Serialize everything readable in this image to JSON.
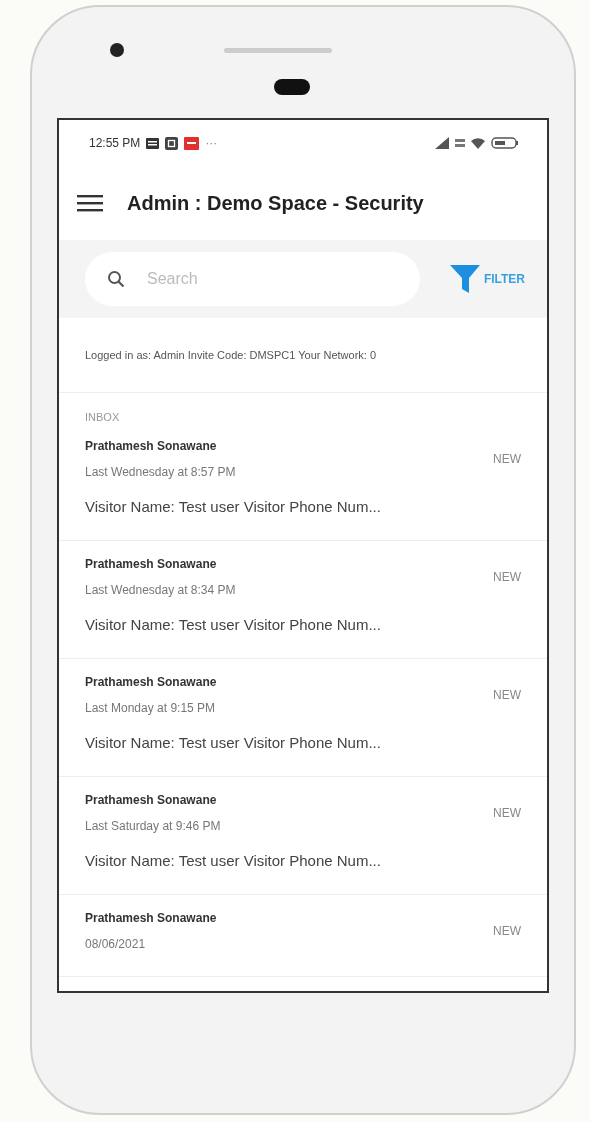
{
  "status_bar": {
    "time": "12:55 PM",
    "more": "···"
  },
  "app_bar": {
    "title": "Admin : Demo Space - Security"
  },
  "search": {
    "placeholder": "Search"
  },
  "filter_button": {
    "label": "FILTER"
  },
  "info": "Logged in as: Admin Invite Code: DMSPC1 Your Network: 0",
  "section_label": "INBOX",
  "messages": [
    {
      "sender": "Prathamesh Sonawane",
      "time": "Last Wednesday at 8:57 PM",
      "preview": "Visitor Name: Test user Visitor Phone Num...",
      "badge": "NEW"
    },
    {
      "sender": "Prathamesh Sonawane",
      "time": "Last Wednesday at 8:34 PM",
      "preview": "Visitor Name: Test user Visitor Phone Num...",
      "badge": "NEW"
    },
    {
      "sender": "Prathamesh Sonawane",
      "time": "Last Monday at 9:15 PM",
      "preview": "Visitor Name: Test user Visitor Phone Num...",
      "badge": "NEW"
    },
    {
      "sender": "Prathamesh Sonawane",
      "time": "Last Saturday at 9:46 PM",
      "preview": "Visitor Name: Test user Visitor Phone Num...",
      "badge": "NEW"
    },
    {
      "sender": "Prathamesh Sonawane",
      "time": "08/06/2021",
      "badge": "NEW"
    }
  ]
}
